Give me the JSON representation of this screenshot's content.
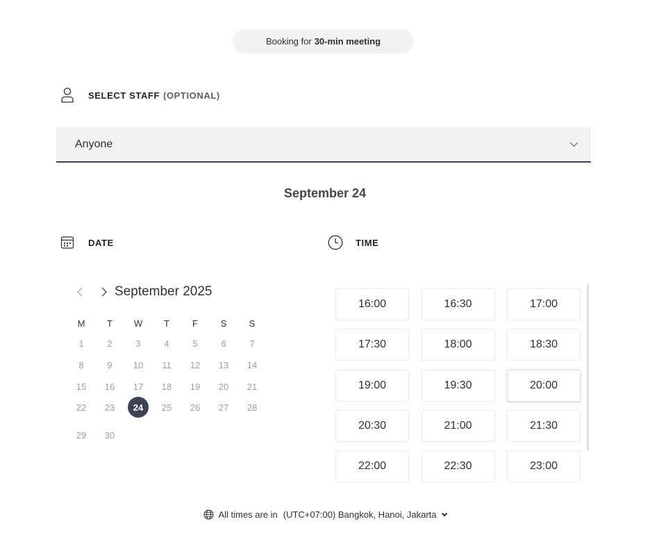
{
  "booking": {
    "prefix": "Booking for",
    "service": "30-min meeting"
  },
  "staff": {
    "heading": "SELECT STAFF",
    "heading_suffix": "(OPTIONAL)",
    "icon": "person-icon",
    "selected": "Anyone"
  },
  "selected_date_title": "September 24",
  "date_section": {
    "heading": "DATE",
    "icon": "calendar-icon"
  },
  "time_section": {
    "heading": "TIME",
    "icon": "clock-icon"
  },
  "calendar": {
    "month_label": "September 2025",
    "weekdays": [
      "M",
      "T",
      "W",
      "T",
      "F",
      "S",
      "S"
    ],
    "weeks": [
      [
        "1",
        "2",
        "3",
        "4",
        "5",
        "6",
        "7"
      ],
      [
        "8",
        "9",
        "10",
        "11",
        "12",
        "13",
        "14"
      ],
      [
        "15",
        "16",
        "17",
        "18",
        "19",
        "20",
        "21"
      ],
      [
        "22",
        "23",
        "24",
        "25",
        "26",
        "27",
        "28"
      ],
      [
        "29",
        "30"
      ]
    ],
    "selected_day": "24"
  },
  "time_slots": [
    "16:00",
    "16:30",
    "17:00",
    "17:30",
    "18:00",
    "18:30",
    "19:00",
    "19:30",
    "20:00",
    "20:30",
    "21:00",
    "21:30",
    "22:00",
    "22:30",
    "23:00"
  ],
  "highlighted_slot": "20:00",
  "timezone": {
    "prefix": "All times are in",
    "zone": "(UTC+07:00) Bangkok, Hanoi, Jakarta"
  },
  "colors": {
    "accent": "#3b4457",
    "select_background": "#f3f2f1",
    "muted_day": "#a19f9d"
  }
}
